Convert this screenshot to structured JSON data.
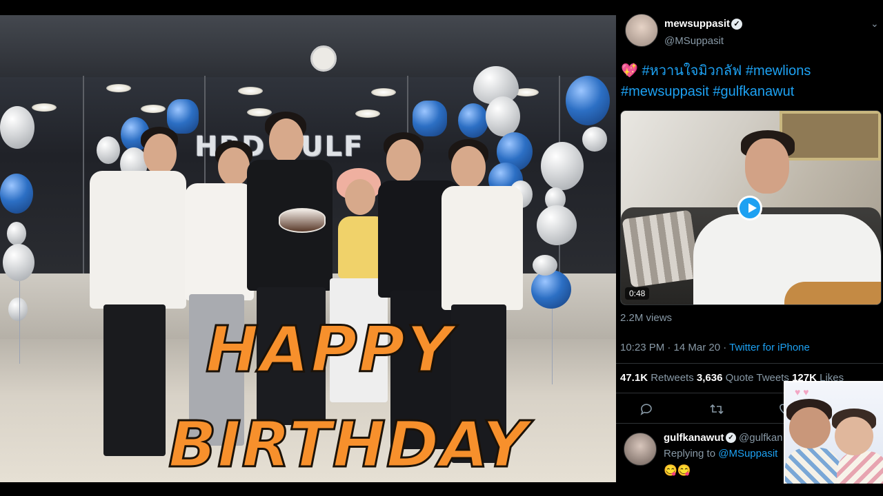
{
  "thumbnail": {
    "photo": {
      "banner_text": "HBD GULF",
      "overlay_line1": "HAPPY",
      "overlay_line2": "BIRTHDAY",
      "overlay_color": "#f7902c"
    }
  },
  "tweet": {
    "display_name": "mewsuppasit",
    "handle": "@MSuppasit",
    "verified_icon": "✓",
    "more_icon": "⌄",
    "text_emoji": "💖",
    "hashtags_line1": " #หวานใจมิวกลัฟ #mewlions",
    "hashtags_line2": "#mewsuppasit #gulfkanawut",
    "video_duration": "0:48",
    "views": "2.2M views",
    "timestamp": "10:23 PM · 14 Mar 20 · ",
    "source": "Twitter for iPhone",
    "retweets_count": "47.1K",
    "retweets_label": " Retweets  ",
    "quote_count": "3,636",
    "quote_label": " Quote Tweets  ",
    "likes_count": "127K",
    "likes_label": " Likes",
    "actions": {
      "reply_icon": "💬",
      "retweet_icon": "⇄",
      "like_icon": "♡"
    },
    "accent_color": "#1da1f2"
  },
  "reply": {
    "display_name": "gulfkanawut",
    "verified_icon": "✓",
    "handle": "@gulfkan",
    "replying_prefix": "Replying to ",
    "replying_mention": "@MSuppasit",
    "text": "😋😋"
  }
}
